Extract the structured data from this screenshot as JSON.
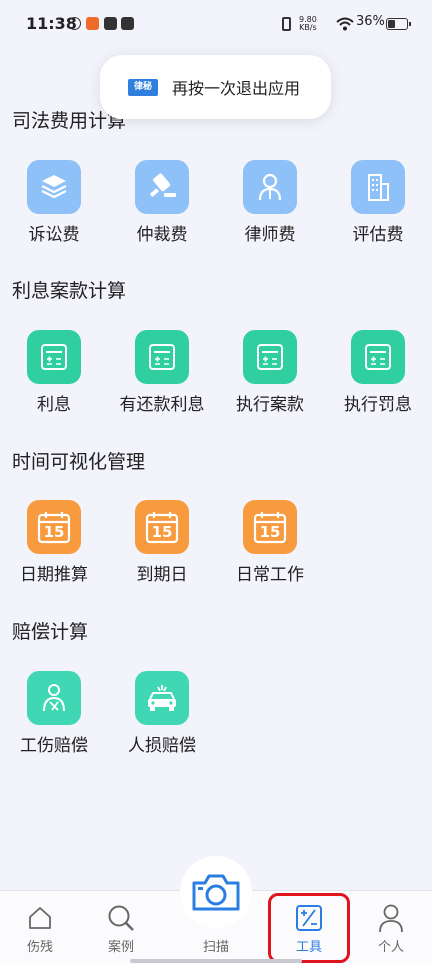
{
  "status_bar": {
    "time": "11:38",
    "net_speed_top": "9.80",
    "net_speed_bottom": "KB/s",
    "battery": "36%"
  },
  "toast": {
    "logo_text": "律秘",
    "message": "再按一次退出应用"
  },
  "sections": [
    {
      "title": "司法费用计算",
      "items": [
        {
          "label": "诉讼费",
          "icon": "books-icon"
        },
        {
          "label": "仲裁费",
          "icon": "gavel-icon"
        },
        {
          "label": "律师费",
          "icon": "lawyer-icon"
        },
        {
          "label": "评估费",
          "icon": "building-icon"
        }
      ]
    },
    {
      "title": "利息案款计算",
      "items": [
        {
          "label": "利息",
          "icon": "calculator-icon"
        },
        {
          "label": "有还款利息",
          "icon": "calculator-icon"
        },
        {
          "label": "执行案款",
          "icon": "calculator-icon"
        },
        {
          "label": "执行罚息",
          "icon": "calculator-icon"
        }
      ]
    },
    {
      "title": "时间可视化管理",
      "items": [
        {
          "label": "日期推算",
          "icon": "calendar-icon",
          "day": "15"
        },
        {
          "label": "到期日",
          "icon": "calendar-icon",
          "day": "15"
        },
        {
          "label": "日常工作",
          "icon": "calendar-icon",
          "day": "15"
        }
      ]
    },
    {
      "title": "赔偿计算",
      "items": [
        {
          "label": "工伤赔偿",
          "icon": "injured-worker-icon"
        },
        {
          "label": "人损赔偿",
          "icon": "car-accident-icon"
        }
      ]
    }
  ],
  "bottom_nav": {
    "items": [
      {
        "label": "伤残",
        "icon": "home-icon"
      },
      {
        "label": "案例",
        "icon": "search-icon"
      },
      {
        "label": "扫描",
        "icon": "camera-icon"
      },
      {
        "label": "工具",
        "icon": "tools-icon",
        "active": true
      },
      {
        "label": "个人",
        "icon": "person-icon"
      }
    ],
    "active_color": "#2a7de1"
  },
  "colors": {
    "blue": "#8ec1f7",
    "green": "#2fcfa0",
    "orange": "#f89a3e",
    "teal": "#3fd7b4",
    "highlight": "#e1141e"
  }
}
